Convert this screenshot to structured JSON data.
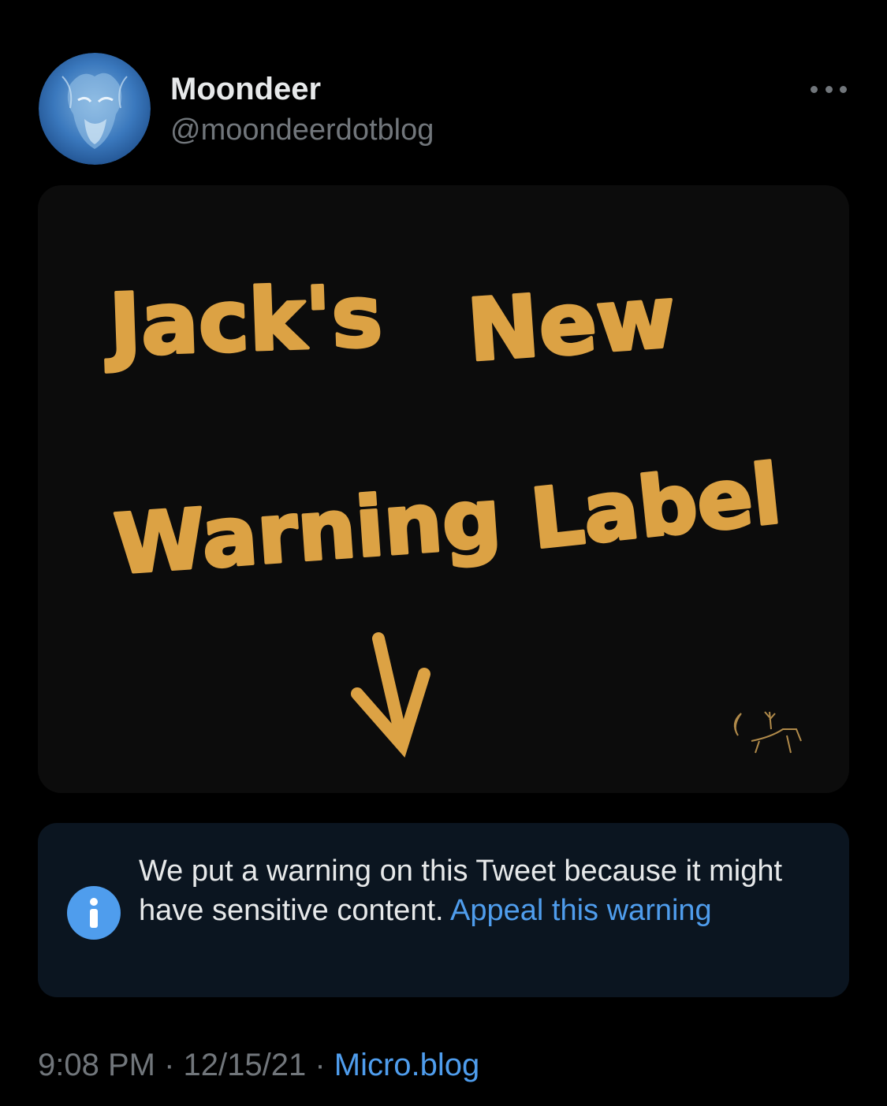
{
  "author": {
    "name": "Moondeer",
    "handle": "@moondeerdotblog",
    "avatar_icon": "wolf-portrait-avatar"
  },
  "more_icon": "ellipsis-icon",
  "media": {
    "line1_word1": "Jack's",
    "line1_word2": "New",
    "line2_word1": "Warning",
    "line2_word2": "Label",
    "arrow_icon": "down-arrow",
    "signature_icon": "moon-deer-signature",
    "ink_color": "#dca244",
    "background": "#0c0c0c"
  },
  "notice": {
    "icon": "info-icon",
    "text": "We put a warning on this Tweet because it might have sensitive content.",
    "link": "Appeal this warning",
    "link_color": "#4f9ded"
  },
  "meta": {
    "time": "9:08 PM",
    "separator": " · ",
    "date": "12/15/21",
    "source": "Micro.blog"
  }
}
